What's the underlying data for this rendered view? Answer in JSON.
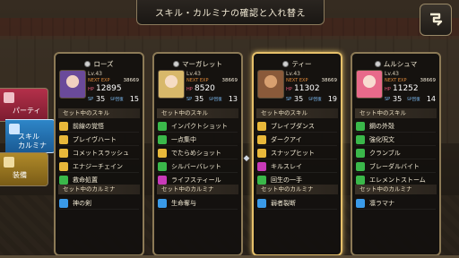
{
  "title": "スキル・カルミナの確認と入れ替え",
  "side_tabs": [
    {
      "label": "パーティ",
      "color": "#b4304a"
    },
    {
      "label": "スキル\nカルミナ",
      "color": "#2e86c8"
    },
    {
      "label": "装備",
      "color": "#b08a2a"
    }
  ],
  "section_labels": {
    "skills": "セット中のスキル",
    "carmina": "セット中のカルミナ"
  },
  "stat_labels": {
    "level_prefix": "Lv.",
    "next_exp": "NEXT EXP",
    "hp": "HP",
    "sp": "SP",
    "sp_recovery": "SP回復"
  },
  "characters": [
    {
      "name": "ローズ",
      "level": "Lv.43",
      "next_exp": "38669",
      "hp": "12895",
      "sp": "35",
      "sp_recovery": "15",
      "portrait_color": "#6a4a9a",
      "skills": [
        {
          "name": "前線の覚悟",
          "icon_color": "#e8b83a"
        },
        {
          "name": "ブレイヴハート",
          "icon_color": "#e8b83a"
        },
        {
          "name": "コメットスラッシュ",
          "icon_color": "#e8b83a"
        },
        {
          "name": "エナジーチェイン",
          "icon_color": "#e8b83a"
        },
        {
          "name": "救命処置",
          "icon_color": "#3ab84a"
        }
      ],
      "carmina": {
        "name": "神の剣",
        "icon_color": "#3a9ae8"
      }
    },
    {
      "name": "マーガレット",
      "level": "Lv.43",
      "next_exp": "38669",
      "hp": "8520",
      "sp": "35",
      "sp_recovery": "13",
      "portrait_color": "#d8b86a",
      "skills": [
        {
          "name": "インパクトショット",
          "icon_color": "#3ab84a"
        },
        {
          "name": "一点集中",
          "icon_color": "#3ab84a"
        },
        {
          "name": "でたらめショット",
          "icon_color": "#e8b83a"
        },
        {
          "name": "シルバーバレット",
          "icon_color": "#3ab84a"
        },
        {
          "name": "ライフスティール",
          "icon_color": "#c83ab8"
        }
      ],
      "carmina": {
        "name": "生命奪与",
        "icon_color": "#3a9ae8"
      }
    },
    {
      "name": "ティー",
      "level": "Lv.43",
      "next_exp": "38669",
      "hp": "11302",
      "sp": "35",
      "sp_recovery": "19",
      "portrait_color": "#8a5a3a",
      "skills": [
        {
          "name": "ブレイブダンス",
          "icon_color": "#e8b83a"
        },
        {
          "name": "ダークアイ",
          "icon_color": "#e8b83a"
        },
        {
          "name": "スナップヒット",
          "icon_color": "#e8b83a"
        },
        {
          "name": "キルスレイ",
          "icon_color": "#c83ab8"
        },
        {
          "name": "回生の一手",
          "icon_color": "#3ab84a"
        }
      ],
      "carmina": {
        "name": "弱者裂断",
        "icon_color": "#3a9ae8"
      }
    },
    {
      "name": "ムルシュマ",
      "level": "Lv.43",
      "next_exp": "38669",
      "hp": "11252",
      "sp": "35",
      "sp_recovery": "14",
      "portrait_color": "#e86a8a",
      "skills": [
        {
          "name": "鋼の外殻",
          "icon_color": "#3ab84a"
        },
        {
          "name": "強化呪文",
          "icon_color": "#3ab84a"
        },
        {
          "name": "クランブル",
          "icon_color": "#3ab84a"
        },
        {
          "name": "ブレーダルバイト",
          "icon_color": "#3ab84a"
        },
        {
          "name": "エレメントストーム",
          "icon_color": "#3ab84a"
        }
      ],
      "carmina": {
        "name": "凛ラマナ",
        "icon_color": "#3a9ae8"
      }
    }
  ],
  "selected_character_index": 2,
  "icons": {
    "back": "back-arrow-icon",
    "swap": "swap-arrows-icon"
  }
}
